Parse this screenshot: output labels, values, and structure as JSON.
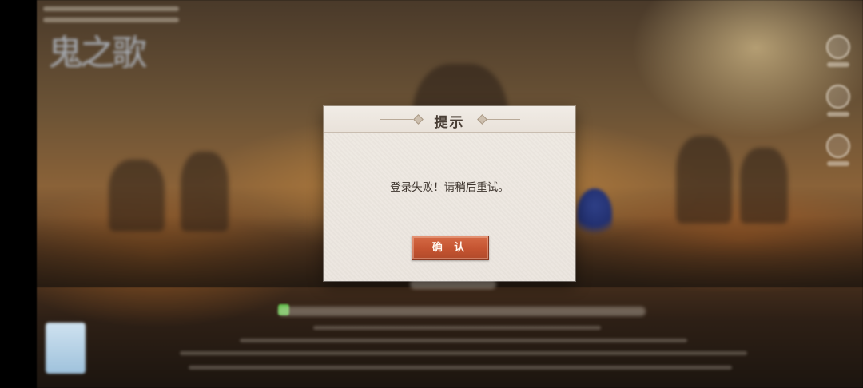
{
  "dialog": {
    "title": "提示",
    "message": "登录失败！请稍后重试。",
    "confirm_label": "确 认"
  },
  "colors": {
    "confirm_button": "#c45431",
    "dialog_background": "#ece6df",
    "title_text": "#4a3f36"
  },
  "icons": [
    "diamond-ornament-icon"
  ]
}
